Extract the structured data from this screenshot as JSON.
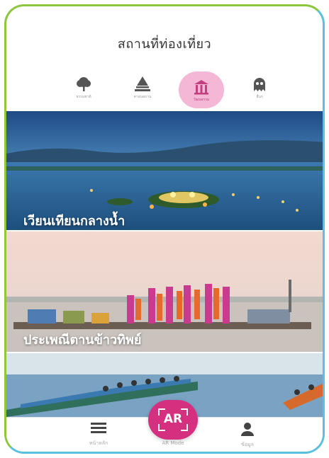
{
  "header": {
    "title": "สถานที่ท่องเที่ยว"
  },
  "categories": [
    {
      "icon": "tree-icon",
      "label": "ธรรมชาติ",
      "active": false
    },
    {
      "icon": "temple-icon",
      "label": "ศาสนสถาน",
      "active": false
    },
    {
      "icon": "museum-icon",
      "label": "วัฒนธรรม",
      "active": true
    },
    {
      "icon": "ghost-icon",
      "label": "อื่นๆ",
      "active": false
    }
  ],
  "cards": [
    {
      "label": "เวียนเทียนกลางน้ำ"
    },
    {
      "label": "ประเพณีตานข้าวทิพย์"
    },
    {
      "label": ""
    }
  ],
  "bottom_nav": {
    "home_label": "หน้าหลัก",
    "ar_label": "AR",
    "ar_caption": "AR Mode",
    "profile_label": "ข้อมูล"
  },
  "colors": {
    "accent": "#d4307f",
    "active_bg": "#f4b8d6",
    "border_left": "#8cc63f",
    "border_right": "#5bc0de"
  }
}
